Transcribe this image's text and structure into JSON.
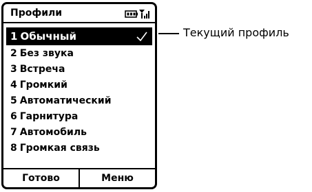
{
  "screen": {
    "title": "Профили",
    "status_icons": [
      "battery-icon",
      "signal-icon"
    ]
  },
  "menu": {
    "items": [
      {
        "number": "1",
        "label": "Обычный",
        "selected": true
      },
      {
        "number": "2",
        "label": "Без звука",
        "selected": false
      },
      {
        "number": "3",
        "label": "Встреча",
        "selected": false
      },
      {
        "number": "4",
        "label": "Громкий",
        "selected": false
      },
      {
        "number": "5",
        "label": "Автоматический",
        "selected": false
      },
      {
        "number": "6",
        "label": "Гарнитура",
        "selected": false
      },
      {
        "number": "7",
        "label": "Автомобиль",
        "selected": false
      },
      {
        "number": "8",
        "label": "Громкая связь",
        "selected": false
      }
    ]
  },
  "softkeys": {
    "left": "Готово",
    "right": "Меню"
  },
  "callout": {
    "text": "Текущий профиль"
  }
}
